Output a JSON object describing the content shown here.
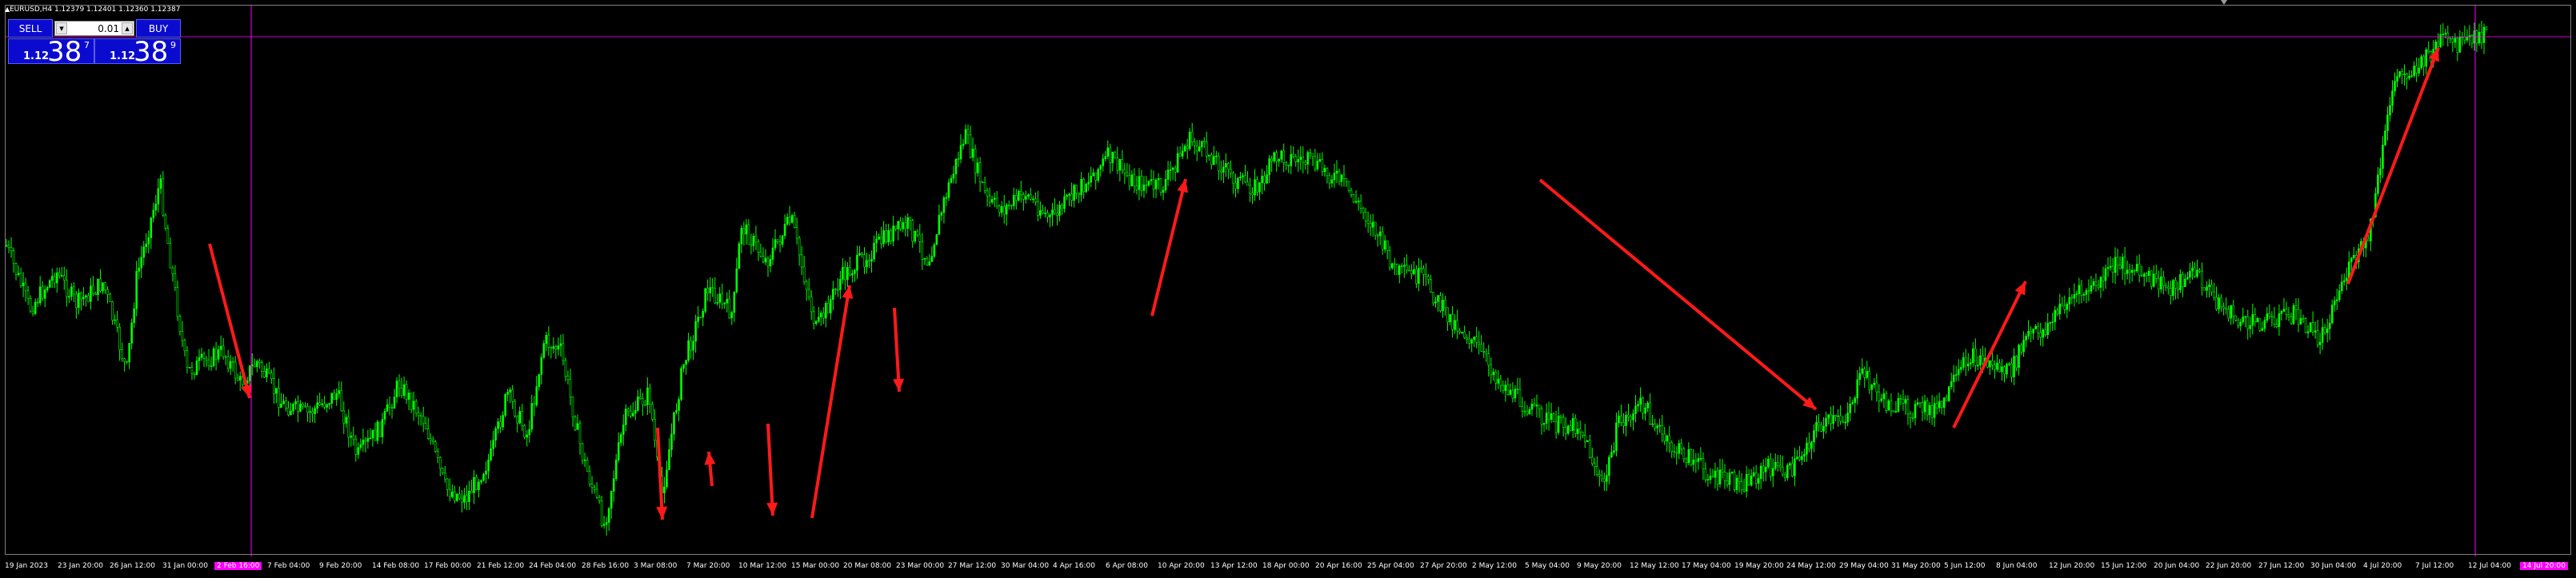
{
  "header": {
    "symbol_info": "EURUSD,H4  1.12379 1.12401 1.12360 1.12387"
  },
  "trade_panel": {
    "sell_label": "SELL",
    "buy_label": "BUY",
    "lot_value": "0.01",
    "minus_label": "▾",
    "plus_label": "▴",
    "bid": {
      "prefix": "1.12",
      "big": "38",
      "sup": "7"
    },
    "ask": {
      "prefix": "1.12",
      "big": "38",
      "sup": "9"
    }
  },
  "colors": {
    "background": "#000000",
    "candles": "#00ff00",
    "arrows": "#ff1a1a",
    "crosshair": "#ff00ff",
    "buttons": "#0b0bd0"
  },
  "time_axis": {
    "labels": [
      "19 Jan 2023",
      "23 Jan 20:00",
      "26 Jan 12:00",
      "31 Jan 00:00",
      "2 Feb 16:00",
      "7 Feb 04:00",
      "9 Feb 20:00",
      "14 Feb 08:00",
      "17 Feb 00:00",
      "21 Feb 12:00",
      "24 Feb 04:00",
      "28 Feb 16:00",
      "3 Mar 08:00",
      "7 Mar 20:00",
      "10 Mar 12:00",
      "15 Mar 00:00",
      "20 Mar 08:00",
      "23 Mar 00:00",
      "27 Mar 12:00",
      "30 Mar 04:00",
      "4 Apr 16:00",
      "6 Apr 08:00",
      "10 Apr 20:00",
      "13 Apr 12:00",
      "18 Apr 00:00",
      "20 Apr 16:00",
      "25 Apr 04:00",
      "27 Apr 20:00",
      "2 May 12:00",
      "5 May 04:00",
      "9 May 20:00",
      "12 May 12:00",
      "17 May 04:00",
      "19 May 20:00",
      "24 May 12:00",
      "29 May 04:00",
      "31 May 20:00",
      "5 Jun 12:00",
      "8 Jun 04:00",
      "12 Jun 20:00",
      "15 Jun 12:00",
      "20 Jun 04:00",
      "22 Jun 20:00",
      "27 Jun 12:00",
      "30 Jun 04:00",
      "4 Jul 20:00",
      "7 Jul 12:00",
      "12 Jul 04:00",
      "14 Jul 20:00"
    ],
    "highlight_left": "2 Feb 16:00",
    "highlight_right": "14 Jul 20:00"
  },
  "chart_data": {
    "type": "candlestick",
    "symbol": "EURUSD",
    "timeframe": "H4",
    "last_close": 1.12387,
    "close_path": [
      [
        0.0,
        0.42
      ],
      [
        0.014,
        0.54
      ],
      [
        0.03,
        0.47
      ],
      [
        0.042,
        0.53
      ],
      [
        0.058,
        0.49
      ],
      [
        0.072,
        0.66
      ],
      [
        0.078,
        0.48
      ],
      [
        0.092,
        0.3
      ],
      [
        0.096,
        0.4
      ],
      [
        0.108,
        0.66
      ],
      [
        0.118,
        0.64
      ],
      [
        0.13,
        0.62
      ],
      [
        0.14,
        0.68
      ],
      [
        0.15,
        0.64
      ],
      [
        0.165,
        0.72
      ],
      [
        0.18,
        0.74
      ],
      [
        0.198,
        0.7
      ],
      [
        0.21,
        0.82
      ],
      [
        0.225,
        0.76
      ],
      [
        0.235,
        0.68
      ],
      [
        0.25,
        0.75
      ],
      [
        0.263,
        0.88
      ],
      [
        0.275,
        0.9
      ],
      [
        0.29,
        0.82
      ],
      [
        0.3,
        0.7
      ],
      [
        0.312,
        0.78
      ],
      [
        0.322,
        0.6
      ],
      [
        0.332,
        0.62
      ],
      [
        0.345,
        0.82
      ],
      [
        0.358,
        0.95
      ],
      [
        0.37,
        0.75
      ],
      [
        0.385,
        0.7
      ],
      [
        0.392,
        0.9
      ],
      [
        0.405,
        0.65
      ],
      [
        0.42,
        0.5
      ],
      [
        0.435,
        0.55
      ],
      [
        0.44,
        0.38
      ],
      [
        0.455,
        0.45
      ],
      [
        0.47,
        0.37
      ],
      [
        0.485,
        0.58
      ],
      [
        0.5,
        0.48
      ],
      [
        0.515,
        0.44
      ],
      [
        0.528,
        0.4
      ],
      [
        0.54,
        0.38
      ],
      [
        0.552,
        0.45
      ],
      [
        0.562,
        0.33
      ],
      [
        0.574,
        0.21
      ],
      [
        0.588,
        0.34
      ],
      [
        0.598,
        0.35
      ],
      [
        0.61,
        0.32
      ],
      [
        0.625,
        0.37
      ],
      [
        0.64,
        0.32
      ],
      [
        0.655,
        0.27
      ],
      [
        0.66,
        0.25
      ],
      [
        0.675,
        0.3
      ],
      [
        0.692,
        0.31
      ],
      [
        0.708,
        0.22
      ],
      [
        0.722,
        0.25
      ],
      [
        0.737,
        0.3
      ],
      [
        0.75,
        0.31
      ],
      [
        0.76,
        0.25
      ],
      [
        0.78,
        0.26
      ],
      [
        0.8,
        0.3
      ],
      [
        0.818,
        0.38
      ],
      [
        0.832,
        0.47
      ],
      [
        0.848,
        0.48
      ],
      [
        0.862,
        0.55
      ],
      [
        0.878,
        0.6
      ],
      [
        0.895,
        0.68
      ],
      [
        0.912,
        0.73
      ],
      [
        0.928,
        0.76
      ],
      [
        0.942,
        0.76
      ],
      [
        0.956,
        0.88
      ],
      [
        0.965,
        0.76
      ],
      [
        0.98,
        0.72
      ],
      [
        0.995,
        0.8
      ],
      [
        1.008,
        0.82
      ],
      [
        1.022,
        0.86
      ],
      [
        1.04,
        0.87
      ],
      [
        1.055,
        0.84
      ],
      [
        1.068,
        0.85
      ],
      [
        1.085,
        0.76
      ],
      [
        1.1,
        0.75
      ],
      [
        1.112,
        0.66
      ],
      [
        1.125,
        0.72
      ],
      [
        1.14,
        0.73
      ],
      [
        1.158,
        0.73
      ],
      [
        1.175,
        0.63
      ],
      [
        1.185,
        0.64
      ],
      [
        1.2,
        0.66
      ],
      [
        1.21,
        0.59
      ],
      [
        1.22,
        0.58
      ],
      [
        1.235,
        0.52
      ],
      [
        1.25,
        0.5
      ],
      [
        1.265,
        0.45
      ],
      [
        1.28,
        0.48
      ],
      [
        1.295,
        0.5
      ],
      [
        1.31,
        0.47
      ],
      [
        1.325,
        0.53
      ],
      [
        1.34,
        0.57
      ],
      [
        1.355,
        0.56
      ],
      [
        1.37,
        0.55
      ],
      [
        1.385,
        0.6
      ],
      [
        1.4,
        0.48
      ],
      [
        1.415,
        0.4
      ],
      [
        1.43,
        0.1
      ],
      [
        1.445,
        0.08
      ],
      [
        1.458,
        0.03
      ],
      [
        1.47,
        0.04
      ],
      [
        1.485,
        0.02
      ]
    ],
    "annotations": "red trend arrows drawn by user"
  }
}
